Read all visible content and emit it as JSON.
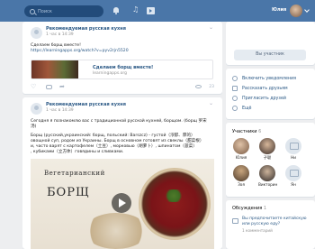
{
  "topbar": {
    "search_placeholder": "Поиск",
    "user_name": "Юлия"
  },
  "post1": {
    "author": "Рекомендуемая русская кухня",
    "time": "1 час в 14:39",
    "text_line1": "Сделаем борщ вместе!",
    "url": "https://learningapps.org/watch?v=pyv2rjn5520",
    "link_title": "Сделаем борщ вместе!",
    "link_domain": "learningapps.org",
    "views": "23"
  },
  "post2": {
    "author": "Рекомендуемая русская кухня",
    "time": "1 час в 14:39",
    "text": [
      "Сегодня я познакомлю вас с традиционной русской кухней, борщом. (борщ 罗宋",
      "汤)",
      "",
      "Борщ (русский,украинский: борщ, польский: Barszcz) - густой（浓郁、厚的）",
      "овощной суп, родом из Украины. Борщ в основном готовят из свеклы（甜菜根）",
      "и, часто варят с картофелем（土豆）, морковью（胡萝卜）, шпинатом（菠菜）",
      ", кубиками（立方体）говядины и сливками."
    ],
    "video_title_small": "Вегетарианский",
    "video_title_big": "БОРЩ"
  },
  "sidebar": {
    "wall_button": "Вы участник",
    "menu": [
      {
        "label": "Включить уведомления",
        "icon": "bell-icon"
      },
      {
        "label": "Рассказать друзьям",
        "icon": "megaphone-icon"
      },
      {
        "label": "Пригласить друзей",
        "icon": "add-user-icon"
      },
      {
        "label": "Ещё",
        "icon": "more-icon"
      }
    ],
    "members": {
      "title": "Участники",
      "count": "6",
      "list": [
        {
          "name": "Юлия"
        },
        {
          "name": "子聪"
        },
        {
          "name": "Ни"
        },
        {
          "name": "Зоя"
        },
        {
          "name": "Викторин"
        },
        {
          "name": "Ян"
        }
      ]
    },
    "discussions": {
      "title": "Обсуждения",
      "count": "1",
      "topic": "Вы предпочитаете китайскую или русскую еду?",
      "sub": "1 комментарий"
    }
  }
}
